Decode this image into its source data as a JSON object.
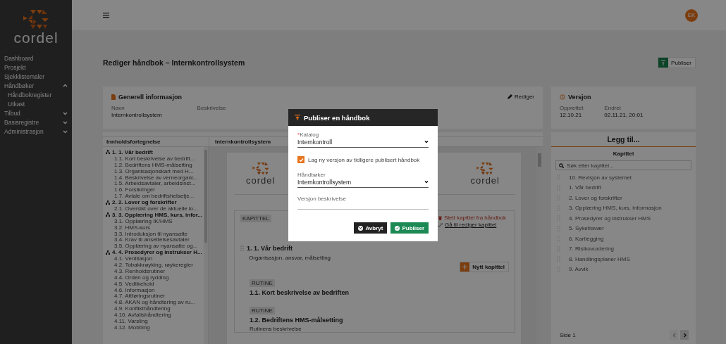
{
  "sidebar": {
    "logo_text": "cordel",
    "items": [
      {
        "label": "Dashboard"
      },
      {
        "label": "Prosjekt"
      },
      {
        "label": "Sjekklistemaler"
      },
      {
        "label": "Håndbøker",
        "expanded": true,
        "children": [
          {
            "label": "Håndbokregister"
          },
          {
            "label": "Utkast"
          }
        ]
      },
      {
        "label": "Tilbud",
        "expanded": false
      },
      {
        "label": "Basisregistre",
        "expanded": false
      },
      {
        "label": "Administrasjon",
        "expanded": false
      }
    ]
  },
  "topbar": {
    "avatar": "EK"
  },
  "page": {
    "title": "Rediger håndbok – Internkontrollsystem",
    "publish_button": "Publiser"
  },
  "general_info": {
    "title": "Generell informasjon",
    "edit": "Rediger",
    "fields": [
      {
        "label": "Navn",
        "value": "Internkontrollsystem"
      },
      {
        "label": "Beskrivelse"
      }
    ]
  },
  "version": {
    "title": "Versjon",
    "fields": [
      {
        "label": "Opprettet",
        "value": "12.10.21"
      },
      {
        "label": "Endret",
        "value": "02.11.21, 20:01"
      }
    ]
  },
  "toc": {
    "title": "Innholdsfortegnelse",
    "sections": [
      {
        "label": "1. 1. Vår bedrift",
        "children": [
          {
            "label": "1.1. Kort beskrivelse av bedrift..."
          },
          {
            "label": "1.2. Bedriftens HMS-målsetting"
          },
          {
            "label": "1.3. Organisasjonskart med H..."
          },
          {
            "label": "1.4. Beskrivelse av verneorgani..."
          },
          {
            "label": "1.5. Arbeidsavtaler, arbeidsinst..."
          },
          {
            "label": "1.6. Forsikringer"
          },
          {
            "label": "1.7. Avtale om bedriftshelsetje..."
          }
        ]
      },
      {
        "label": "2. 2. Lover og forskrifter",
        "children": [
          {
            "label": "2.1. Oversikt over de aktuelle lo..."
          }
        ]
      },
      {
        "label": "3. 3. Opplæring HMS, kurs, infor...",
        "children": [
          {
            "label": "3.1. Opplæring IK/HMS"
          },
          {
            "label": "3.2. HMS-kurs"
          },
          {
            "label": "3.3. Introduksjon til nyansatte"
          },
          {
            "label": "3.4. Krav til ansettelsesavtaler"
          },
          {
            "label": "3.5. Opplæring av nyansatte og..."
          }
        ]
      },
      {
        "label": "4. 4. Prosedyrer og instrukser H...",
        "children": [
          {
            "label": "4.1. Ventilasjon"
          },
          {
            "label": "4.2. Tobakkrøyking, røykeregler"
          },
          {
            "label": "4.3. Renholdsrutiner"
          },
          {
            "label": "4.4. Orden og rydding"
          },
          {
            "label": "4.5. Vedlikehold"
          },
          {
            "label": "4.6. Informasjon"
          },
          {
            "label": "4.7. Attføringsrutiner"
          },
          {
            "label": "4.8. AKAN og håndtering av ru..."
          },
          {
            "label": "4.9. Konflikthåndtering"
          },
          {
            "label": "4.10. Avfallshåndtering"
          },
          {
            "label": "4.11. Varsling"
          },
          {
            "label": "4.12. Mobbing"
          }
        ]
      }
    ]
  },
  "document": {
    "title": "Internkontrollsystem",
    "logo_left": "cordel",
    "logo_right": "cordel",
    "chapter": {
      "tag": "KAPITTEL",
      "delete_link": "Slett kapittel fra håndbok",
      "edit_link": "Gå til rediger kapittel",
      "title": "1. 1. Vår bedrift",
      "description": "Organisasjon, ansvar, målsetting",
      "new_button": "Nytt kapittel",
      "routines": [
        {
          "tag": "RUTINE",
          "title": "1.1. Kort beskrivelse av bedriften"
        },
        {
          "tag": "RUTINE",
          "title": "1.2. Bedriftens HMS-målsetting",
          "description": "Rutinens beskrivelse"
        }
      ]
    }
  },
  "add_panel": {
    "title": "Legg til...",
    "subtitle": "Kapittel",
    "search": {
      "placeholder": "Søk etter kapittel..."
    },
    "items": [
      {
        "label": "10. Revisjon av systemet"
      },
      {
        "label": "1. Vår bedrift"
      },
      {
        "label": "2. Lover og forskrifter"
      },
      {
        "label": "3. Opplæring HMS, kurs, informasjon"
      },
      {
        "label": "4. Prosedyrer og instrukser HMS"
      },
      {
        "label": "5. Sykefravær"
      },
      {
        "label": "6. Kartlegging"
      },
      {
        "label": "7. Risikovurdering"
      },
      {
        "label": "8. Handlingsplaner HMS"
      },
      {
        "label": "9. Avvik"
      }
    ],
    "page_label": "Side 1",
    "prev": {
      "disabled": true
    },
    "next": {
      "disabled": false
    }
  },
  "modal": {
    "title": "Publiser en håndbok",
    "fields": [
      {
        "kind": "select",
        "label": "Katalog",
        "required_mark": "*",
        "value": "Internkontroll"
      },
      {
        "kind": "checkbox",
        "label": "Lag ny versjon av tidligere publisert håndbok",
        "checked": true
      },
      {
        "kind": "select",
        "label": "Håndbøker",
        "value": "Internkontrollsystem"
      },
      {
        "kind": "text",
        "label": "Versjon beskrivelse"
      }
    ],
    "buttons": [
      {
        "kind": "cancel",
        "label": "Avbryt"
      },
      {
        "kind": "primary",
        "label": "Publiser"
      }
    ]
  }
}
